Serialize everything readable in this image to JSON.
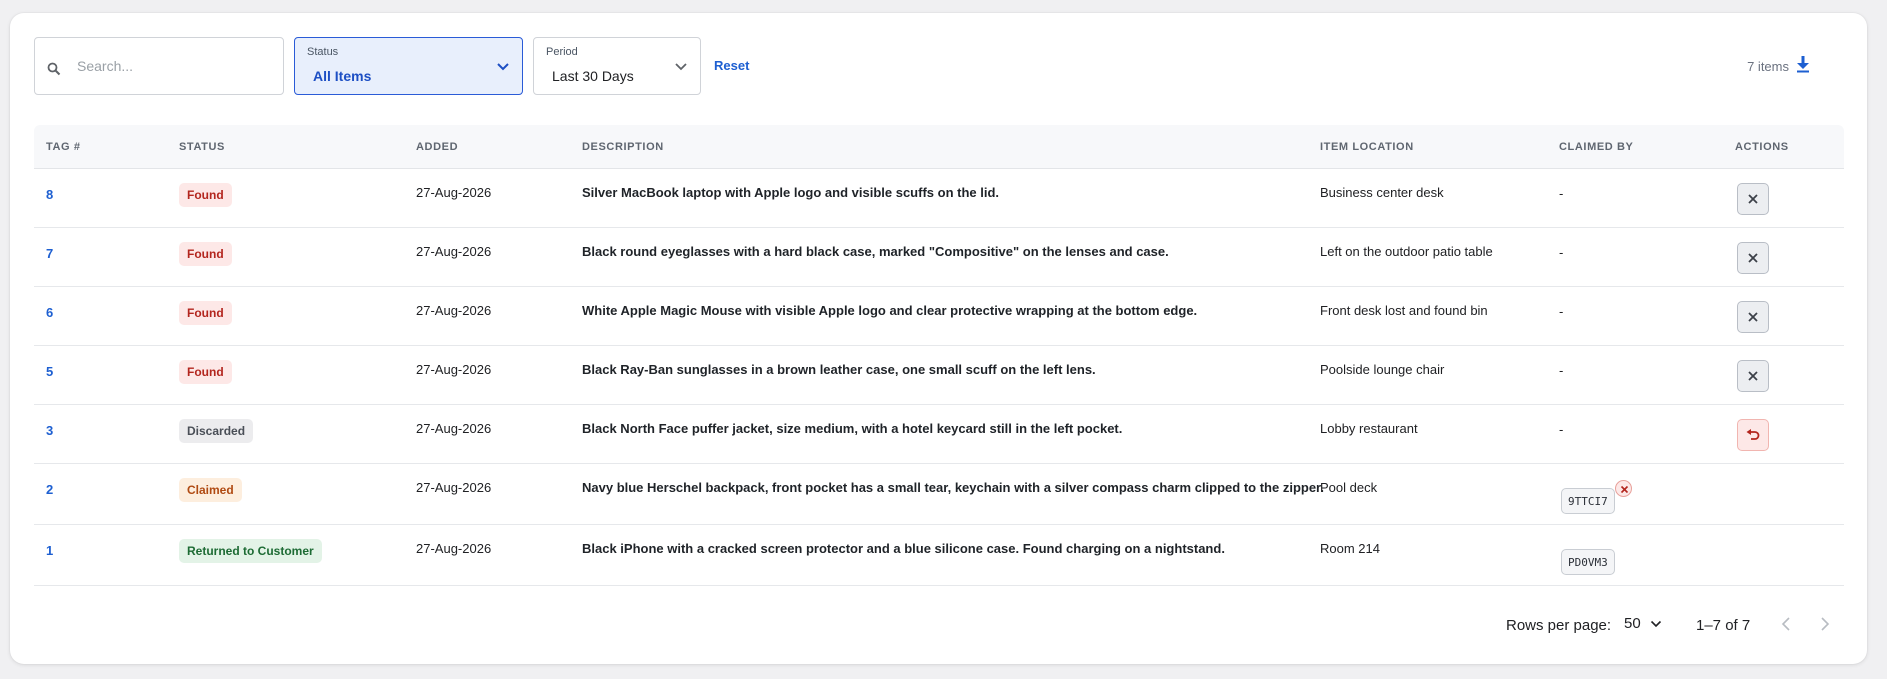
{
  "toolbar": {
    "search_placeholder": "Search...",
    "status_label": "Status",
    "status_value": "All Items",
    "period_label": "Period",
    "period_value": "Last 30 Days",
    "reset_label": "Reset",
    "item_count": "7 items"
  },
  "columns": [
    "TAG #",
    "STATUS",
    "ADDED",
    "DESCRIPTION",
    "ITEM LOCATION",
    "CLAIMED BY",
    "ACTIONS"
  ],
  "rows": [
    {
      "tag": "8",
      "status": "Found",
      "added": "27-Aug-2026",
      "description": "Silver MacBook laptop with Apple logo and visible scuffs on the lid.",
      "location": "Business center desk",
      "claimed_by": "-",
      "action": "close"
    },
    {
      "tag": "7",
      "status": "Found",
      "added": "27-Aug-2026",
      "description": "Black round eyeglasses with a hard black case, marked \"Compositive\" on the lenses and case.",
      "location": "Left on the outdoor patio table",
      "claimed_by": "-",
      "action": "close"
    },
    {
      "tag": "6",
      "status": "Found",
      "added": "27-Aug-2026",
      "description": "White Apple Magic Mouse with visible Apple logo and clear protective wrapping at the bottom edge.",
      "location": "Front desk lost and found bin",
      "claimed_by": "-",
      "action": "close"
    },
    {
      "tag": "5",
      "status": "Found",
      "added": "27-Aug-2026",
      "description": "Black Ray-Ban sunglasses in a brown leather case, one small scuff on the left lens.",
      "location": "Poolside lounge chair",
      "claimed_by": "-",
      "action": "close"
    },
    {
      "tag": "3",
      "status": "Discarded",
      "added": "27-Aug-2026",
      "description": "Black North Face puffer jacket, size medium, with a hotel keycard still in the left pocket.",
      "location": "Lobby restaurant",
      "claimed_by": "-",
      "action": "undo"
    },
    {
      "tag": "2",
      "status": "Claimed",
      "added": "27-Aug-2026",
      "description": "Navy blue Herschel backpack, front pocket has a small tear, keychain with a silver compass charm clipped to the zipper.",
      "location": "Pool deck",
      "claimed_by": "9TTCI7",
      "action": "none"
    },
    {
      "tag": "1",
      "status": "Returned to Customer",
      "added": "27-Aug-2026",
      "description": "Black iPhone with a cracked screen protector and a blue silicone case. Found charging on a nightstand.",
      "location": "Room 214",
      "claimed_by": "PD0VM3",
      "action": "none"
    }
  ],
  "pagination": {
    "rows_per_page_label": "Rows per page:",
    "rows_per_page": "50",
    "range": "1–7 of 7"
  },
  "colors": {
    "accent": "#1d5fd1",
    "found": "#b3261e",
    "claimed": "#b04a12",
    "returned": "#1d6b34"
  },
  "icons": {
    "search": "search-icon",
    "download": "download-icon",
    "close": "close-icon",
    "undo": "undo-icon"
  }
}
